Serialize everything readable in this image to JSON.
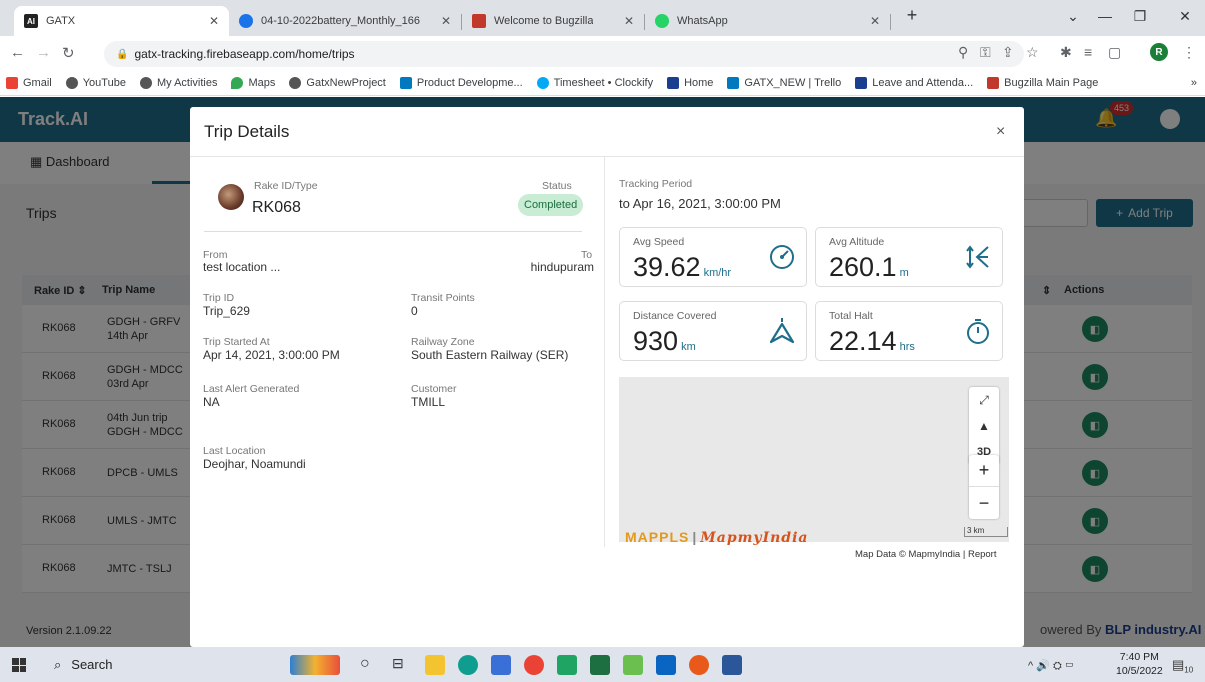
{
  "browser": {
    "tabs": [
      {
        "title": "GATX",
        "active": true
      },
      {
        "title": "04-10-2022battery_Monthly_166",
        "active": false
      },
      {
        "title": "Welcome to Bugzilla",
        "active": false
      },
      {
        "title": "WhatsApp",
        "active": false
      }
    ],
    "new_tab": "+",
    "url": "gatx-tracking.firebaseapp.com/home/trips",
    "profile_initial": "R",
    "bookmarks": [
      "Gmail",
      "YouTube",
      "My Activities",
      "Maps",
      "GatxNewProject",
      "Product Developme...",
      "Timesheet • Clockify",
      "Home",
      "GATX_NEW | Trello",
      "Leave and Attenda...",
      "Bugzilla Main Page"
    ],
    "bookmarks_more": "»"
  },
  "app": {
    "logo": "Track.AI",
    "notification_count": "453",
    "nav_dashboard": "Dashboard",
    "page_title": "Trips",
    "add_trip_label": "Add Trip",
    "table_headers": {
      "rake_id": "Rake ID",
      "trip_name": "Trip Name",
      "actions": "Actions"
    },
    "rows": [
      {
        "rake": "RK068",
        "name1": "GDGH - GRFV",
        "name2": "14th Apr"
      },
      {
        "rake": "RK068",
        "name1": "GDGH - MDCC",
        "name2": "03rd Apr"
      },
      {
        "rake": "RK068",
        "name1": "04th Jun trip",
        "name2": "GDGH - MDCC"
      },
      {
        "rake": "RK068",
        "name1": "DPCB - UMLS",
        "name2": ""
      },
      {
        "rake": "RK068",
        "name1": "UMLS - JMTC",
        "name2": ""
      },
      {
        "rake": "RK068",
        "name1": "JMTC - TSLJ",
        "name2": ""
      }
    ],
    "version": "Version 2.1.09.22",
    "powered_prefix": "owered By",
    "powered_brand": "BLP industry.AI"
  },
  "modal": {
    "title": "Trip Details",
    "close": "×",
    "rake_label": "Rake ID/Type",
    "rake_value": "RK068",
    "status_label": "Status",
    "status_value": "Completed",
    "from_label": "From",
    "from_value": "test location ...",
    "to_label": "To",
    "to_value": "hindupuram",
    "trip_id_label": "Trip ID",
    "trip_id_value": "Trip_629",
    "transit_label": "Transit Points",
    "transit_value": "0",
    "started_label": "Trip Started At",
    "started_value": "Apr 14, 2021, 3:00:00 PM",
    "zone_label": "Railway Zone",
    "zone_value": "South Eastern Railway (SER)",
    "alert_label": "Last Alert Generated",
    "alert_value": "NA",
    "customer_label": "Customer",
    "customer_value": "TMILL",
    "location_label": "Last Location",
    "location_value": "Deojhar, Noamundi",
    "tracking_label": "Tracking Period",
    "tracking_value": "to Apr 16, 2021, 3:00:00 PM",
    "stats": {
      "speed": {
        "label": "Avg Speed",
        "value": "39.62",
        "unit": "km/hr",
        "icon": "speedometer-icon"
      },
      "altitude": {
        "label": "Avg Altitude",
        "value": "260.1",
        "unit": "m",
        "icon": "altitude-icon"
      },
      "distance": {
        "label": "Distance Covered",
        "value": "930",
        "unit": "km",
        "icon": "navigation-arrow-icon"
      },
      "halt": {
        "label": "Total Halt",
        "value": "22.14",
        "unit": "hrs",
        "icon": "stopwatch-icon"
      }
    },
    "map": {
      "mode_3d": "3D",
      "zoom_in": "+",
      "zoom_out": "−",
      "brand": "MAPPLS",
      "brand2": "MapmyIndia",
      "scale": "3 km",
      "attribution": "Map Data © MapmyIndia | Report"
    }
  },
  "taskbar": {
    "search_placeholder": "Search",
    "time": "7:40 PM",
    "date": "10/5/2022",
    "notifications": "10"
  },
  "colors": {
    "header": "#1f6e8c",
    "status_bg": "#c8ecd4",
    "action": "#1a8a60"
  }
}
